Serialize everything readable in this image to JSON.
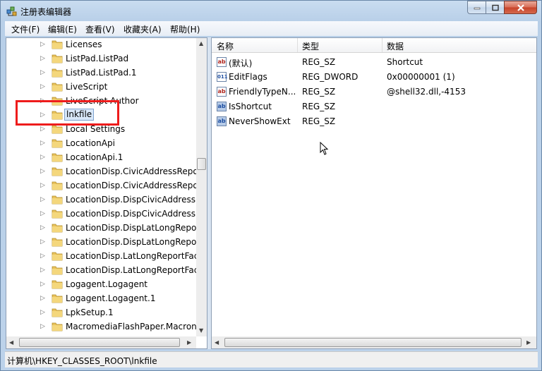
{
  "window": {
    "title": "注册表编辑器",
    "icon": "registry-editor-icon"
  },
  "caption_buttons": {
    "minimize": "minimize-icon",
    "maximize": "maximize-icon",
    "close": "close-icon"
  },
  "menu": [
    "文件(F)",
    "编辑(E)",
    "查看(V)",
    "收藏夹(A)",
    "帮助(H)"
  ],
  "tree": {
    "selected": "lnkfile",
    "items": [
      "Licenses",
      "ListPad.ListPad",
      "ListPad.ListPad.1",
      "LiveScript",
      "LiveScript Author",
      "lnkfile",
      "Local Settings",
      "LocationApi",
      "LocationApi.1",
      "LocationDisp.CivicAddressRepo",
      "LocationDisp.CivicAddressRepo",
      "LocationDisp.DispCivicAddressR",
      "LocationDisp.DispCivicAddressR",
      "LocationDisp.DispLatLongRepor",
      "LocationDisp.DispLatLongRepor",
      "LocationDisp.LatLongReportFac",
      "LocationDisp.LatLongReportFac",
      "Logagent.Logagent",
      "Logagent.Logagent.1",
      "LpkSetup.1",
      "MacromediaFlashPaper.Macron"
    ]
  },
  "values": {
    "columns": {
      "name": "名称",
      "type": "类型",
      "data": "数据"
    },
    "rows": [
      {
        "name": "(默认)",
        "type": "REG_SZ",
        "data": "Shortcut",
        "icon": "string-value-icon"
      },
      {
        "name": "EditFlags",
        "type": "REG_DWORD",
        "data": "0x00000001 (1)",
        "icon": "binary-value-icon"
      },
      {
        "name": "FriendlyTypeN...",
        "type": "REG_SZ",
        "data": "@shell32.dll,-4153",
        "icon": "string-value-icon"
      },
      {
        "name": "IsShortcut",
        "type": "REG_SZ",
        "data": "",
        "icon": "string-value-icon"
      },
      {
        "name": "NeverShowExt",
        "type": "REG_SZ",
        "data": "",
        "icon": "string-value-icon"
      }
    ]
  },
  "status": {
    "path": "计算机\\HKEY_CLASSES_ROOT\\lnkfile"
  },
  "colors": {
    "annotation": "#ee1c1c",
    "selection": "#d9e8f9"
  }
}
